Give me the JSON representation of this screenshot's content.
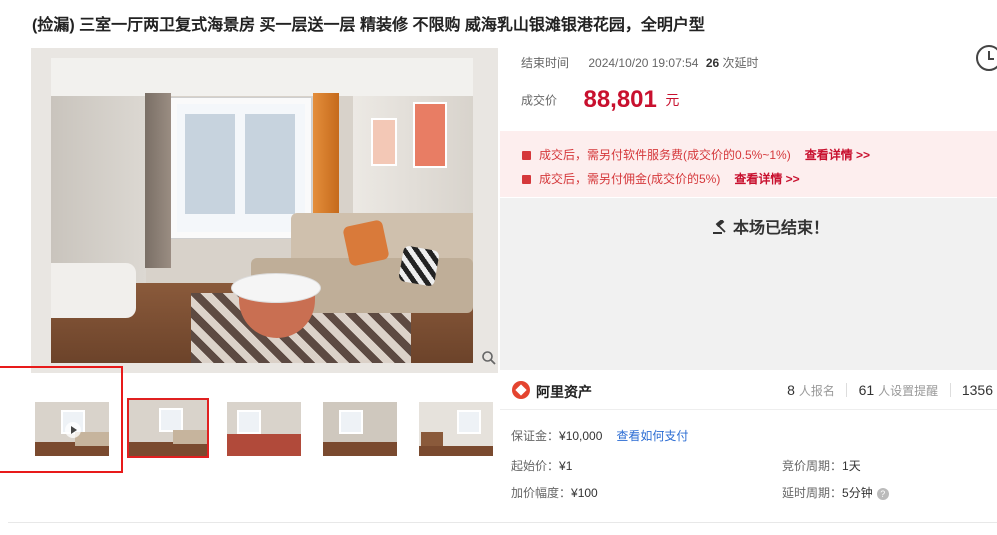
{
  "title": "(捡漏) 三室一厅两卫复式海景房 买一层送一层 精装修 不限购 威海乳山银滩银港花园，全明户型",
  "auction": {
    "end_label": "结束时间",
    "end_time": "2024/10/20 19:07:54",
    "delay_count": "26",
    "delay_suffix": "次延时",
    "price_label": "成交价",
    "price": "88,801",
    "price_unit": "元",
    "status": "本场已结束！"
  },
  "notices": [
    {
      "text": "成交后，需另付软件服务费(成交价的0.5%~1%)",
      "link": "查看详情 >>"
    },
    {
      "text": "成交后，需另付佣金(成交价的5%)",
      "link": "查看详情 >>"
    }
  ],
  "brand": {
    "name": "阿里资产",
    "signups": "8",
    "signups_label": "人报名",
    "reminders": "61",
    "reminders_label": "人设置提醒",
    "views": "1356"
  },
  "details": {
    "deposit_label": "保证金：",
    "deposit": "¥10,000",
    "deposit_link": "查看如何支付",
    "start_label": "起始价：",
    "start": "¥1",
    "increment_label": "加价幅度：",
    "increment": "¥100",
    "cycle_label": "竞价周期：",
    "cycle": "1天",
    "delay_label": "延时周期：",
    "delay": "5分钟"
  },
  "thumbnails": [
    "video",
    "photo-1",
    "photo-2",
    "photo-3",
    "photo-4"
  ],
  "colors": {
    "price": "#c8102e",
    "notice_bg": "#fdeeee",
    "link": "#2b6cd3",
    "highlight": "#e81a1a"
  }
}
